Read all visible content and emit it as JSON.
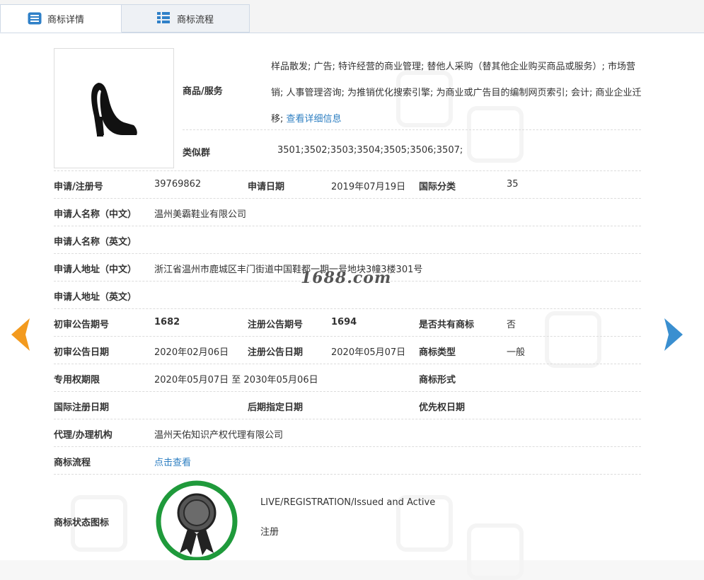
{
  "tabs": [
    {
      "label": "商标详情",
      "icon": "list-icon"
    },
    {
      "label": "商标流程",
      "icon": "grid-icon"
    }
  ],
  "goods": {
    "label": "商品/服务",
    "text": "样品散发; 广告; 特许经营的商业管理; 替他人采购（替其他企业购买商品或服务）; 市场营销; 人事管理咨询; 为推销优化搜索引擎; 为商业或广告目的编制网页索引; 会计; 商业企业迁移;",
    "more_link": "查看详细信息"
  },
  "similar_group": {
    "label": "类似群",
    "value": "3501;3502;3503;3504;3505;3506;3507;"
  },
  "fields": {
    "reg_no_label": "申请/注册号",
    "reg_no": "39769862",
    "apply_date_label": "申请日期",
    "apply_date": "2019年07月19日",
    "intl_class_label": "国际分类",
    "intl_class": "35",
    "applicant_cn_label": "申请人名称（中文）",
    "applicant_cn": "温州美霸鞋业有限公司",
    "applicant_en_label": "申请人名称（英文）",
    "applicant_en": "",
    "address_cn_label": "申请人地址（中文）",
    "address_cn": "浙江省温州市鹿城区丰门街道中国鞋都一期一号地块3幢3楼301号",
    "address_en_label": "申请人地址（英文）",
    "address_en": "",
    "prelim_no_label": "初审公告期号",
    "prelim_no": "1682",
    "reg_pub_no_label": "注册公告期号",
    "reg_pub_no": "1694",
    "shared_label": "是否共有商标",
    "shared": "否",
    "prelim_date_label": "初审公告日期",
    "prelim_date": "2020年02月06日",
    "reg_pub_date_label": "注册公告日期",
    "reg_pub_date": "2020年05月07日",
    "tm_type_label": "商标类型",
    "tm_type": "一般",
    "exclusive_label": "专用权期限",
    "exclusive": "2020年05月07日 至 2030年05月06日",
    "tm_form_label": "商标形式",
    "tm_form": "",
    "intl_reg_date_label": "国际注册日期",
    "intl_reg_date": "",
    "later_date_label": "后期指定日期",
    "later_date": "",
    "priority_label": "优先权日期",
    "priority": "",
    "agent_label": "代理/办理机构",
    "agent": "温州天佑知识产权代理有限公司",
    "flow_label": "商标流程",
    "flow_link": "点击查看",
    "status_label": "商标状态图标",
    "status_en": "LIVE/REGISTRATION/Issued and Active",
    "status_cn": "注册"
  },
  "watermark": "1688.com",
  "colors": {
    "link": "#2e7fc2",
    "prev_arrow": "#f39a1e",
    "next_arrow": "#3a8fd0",
    "status_ring": "#1f9a3b"
  }
}
